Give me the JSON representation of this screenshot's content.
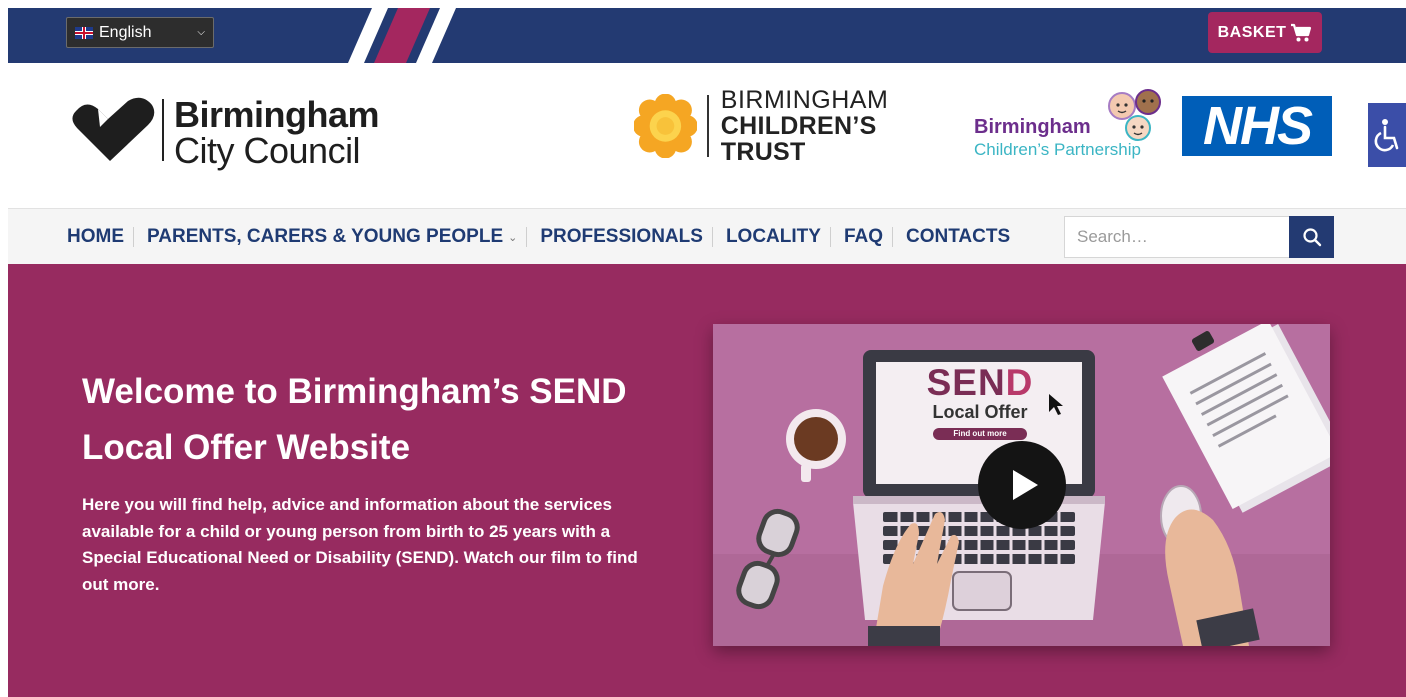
{
  "topbar": {
    "language": {
      "selected": "English",
      "flag": "uk-flag-icon"
    },
    "basket_label": "BASKET",
    "colors": {
      "bar": "#233a72",
      "stripe_pink": "#a4275f",
      "stripe_white": "#ffffff",
      "basket_bg": "#a4275f"
    }
  },
  "logos": {
    "bcc": {
      "line1": "Birmingham",
      "line2": "City Council"
    },
    "bct": {
      "line1": "BIRMINGHAM",
      "line2": "CHILDREN’S TRUST"
    },
    "bcp": {
      "line1": "Birmingham",
      "line2": "Children’s Partnership"
    },
    "nhs": {
      "text": "NHS",
      "color": "#005eb8"
    }
  },
  "accessibility": {
    "icon": "wheelchair-icon"
  },
  "nav": {
    "items": [
      {
        "label": "HOME",
        "has_dropdown": false
      },
      {
        "label": "PARENTS, CARERS & YOUNG PEOPLE",
        "has_dropdown": true
      },
      {
        "label": "PROFESSIONALS",
        "has_dropdown": false
      },
      {
        "label": "LOCALITY",
        "has_dropdown": false
      },
      {
        "label": "FAQ",
        "has_dropdown": false
      },
      {
        "label": "CONTACTS",
        "has_dropdown": false
      }
    ],
    "search": {
      "placeholder": "Search…",
      "value": "",
      "icon": "search-icon"
    }
  },
  "hero": {
    "title": "Welcome to Birmingham’s SEND Local Offer Website",
    "text": "Here you will find help, advice and information about the services available for a child or young person from birth to 25 years with a Special Educational Need or Disability (SEND).  Watch our film to find out more.",
    "bg_color": "#972b60",
    "video": {
      "screen_title_1": "SEN",
      "screen_title_2": "D",
      "screen_subtitle": "Local Offer",
      "screen_button": "Find out more",
      "play_icon": "play-icon"
    }
  }
}
